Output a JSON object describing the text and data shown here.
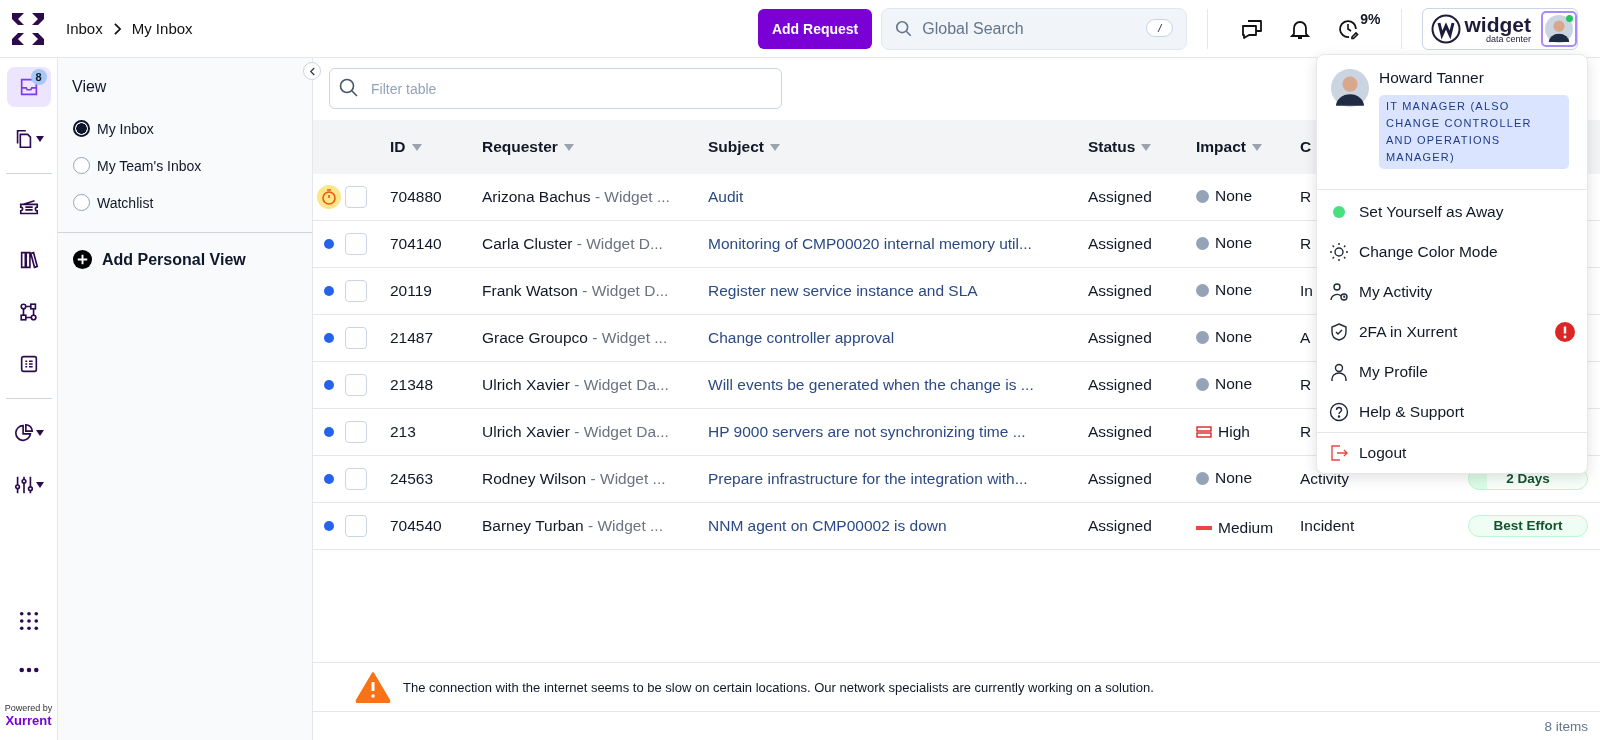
{
  "breadcrumb": [
    {
      "label": "Inbox"
    },
    {
      "label": "My Inbox"
    }
  ],
  "add_request": "Add Request",
  "search": {
    "placeholder": "Global Search",
    "shortcut": "/"
  },
  "usage": "9%",
  "account": {
    "name": "widget",
    "tagline": "data center",
    "online": true
  },
  "rail": {
    "items": [
      {
        "kind": "inbox",
        "selected": true,
        "badge": "8"
      },
      {
        "kind": "documents",
        "selected": false,
        "menu": true
      },
      {
        "kind": "divider"
      },
      {
        "kind": "ticket",
        "selected": false
      },
      {
        "kind": "books",
        "selected": false
      },
      {
        "kind": "workflow",
        "selected": false
      },
      {
        "kind": "list",
        "selected": false
      },
      {
        "kind": "divider"
      },
      {
        "kind": "chart",
        "selected": false,
        "menu": true
      },
      {
        "kind": "sliders",
        "selected": false,
        "menu": true
      }
    ],
    "powered_by": "Powered by",
    "brand": "Xurrent"
  },
  "view_panel": {
    "title": "View",
    "views": [
      {
        "label": "My Inbox",
        "selected": true
      },
      {
        "label": "My Team's Inbox",
        "selected": false
      },
      {
        "label": "Watchlist",
        "selected": false
      }
    ],
    "add": "Add Personal View"
  },
  "filter": {
    "placeholder": "Filter table"
  },
  "table": {
    "columns": [
      {
        "label": "ID",
        "sortable": true
      },
      {
        "label": "Requester",
        "sortable": true
      },
      {
        "label": "Subject",
        "sortable": true
      },
      {
        "label": "Status",
        "sortable": true
      },
      {
        "label": "Impact",
        "sortable": true
      },
      {
        "label": "C",
        "sortable": false
      }
    ],
    "rows": [
      {
        "kind": "timer",
        "checked": false,
        "id": "704880",
        "requester": "Arizona Bachus",
        "organization": "- Widget ...",
        "subject": "Audit",
        "status": "Assigned",
        "impact": {
          "kind": "none",
          "label": "None"
        },
        "category": "R"
      },
      {
        "kind": "unread",
        "checked": false,
        "id": "704140",
        "requester": "Carla Cluster",
        "organization": "- Widget D...",
        "subject": "Monitoring of CMP00020 internal memory util...",
        "status": "Assigned",
        "impact": {
          "kind": "none",
          "label": "None"
        },
        "category": "R"
      },
      {
        "kind": "unread",
        "checked": false,
        "id": "20119",
        "requester": "Frank Watson",
        "organization": "- Widget D...",
        "subject": "Register new service instance and SLA",
        "status": "Assigned",
        "impact": {
          "kind": "none",
          "label": "None"
        },
        "category": "In"
      },
      {
        "kind": "unread",
        "checked": false,
        "id": "21487",
        "requester": "Grace Groupco",
        "organization": "- Widget ...",
        "subject": "Change controller approval",
        "status": "Assigned",
        "impact": {
          "kind": "none",
          "label": "None"
        },
        "category": "A"
      },
      {
        "kind": "unread",
        "checked": false,
        "id": "21348",
        "requester": "Ulrich Xavier",
        "organization": "- Widget Da...",
        "subject": "Will events be generated when the change is ...",
        "status": "Assigned",
        "impact": {
          "kind": "none",
          "label": "None"
        },
        "category": "R"
      },
      {
        "kind": "unread",
        "checked": false,
        "id": "213",
        "requester": "Ulrich Xavier",
        "organization": "- Widget Da...",
        "subject": "HP 9000 servers are not synchronizing time ...",
        "status": "Assigned",
        "impact": {
          "kind": "high",
          "label": "High"
        },
        "category": "R"
      },
      {
        "kind": "unread",
        "checked": false,
        "id": "24563",
        "requester": "Rodney Wilson",
        "organization": "- Widget ...",
        "subject": "Prepare infrastructure for the integration with...",
        "status": "Assigned",
        "impact": {
          "kind": "none",
          "label": "None"
        },
        "category": "Activity",
        "sla": {
          "label": "2 Days"
        }
      },
      {
        "kind": "unread",
        "checked": false,
        "id": "704540",
        "requester": "Barney Turban",
        "organization": "- Widget ...",
        "subject": "NNM agent on CMP00002 is down",
        "status": "Assigned",
        "impact": {
          "kind": "medium",
          "label": "Medium"
        },
        "category": "Incident",
        "sla": {
          "label": "Best Effort"
        }
      }
    ]
  },
  "alert": "The connection with the internet seems to be slow on certain locations. Our network specialists are currently working on a solution.",
  "item_count": "8 items",
  "user_menu": {
    "name": "Howard Tanner",
    "role": "IT MANAGER (ALSO CHANGE CONTROLLER AND OPERATIONS MANAGER)",
    "items": [
      {
        "kind": "away",
        "label": "Set Yourself as Away"
      },
      {
        "kind": "theme",
        "label": "Change Color Mode"
      },
      {
        "kind": "activity",
        "label": "My Activity"
      },
      {
        "kind": "security",
        "label": "2FA in Xurrent",
        "alert": true
      },
      {
        "kind": "profile",
        "label": "My Profile"
      },
      {
        "kind": "help",
        "label": "Help & Support"
      },
      {
        "kind": "logout",
        "label": "Logout"
      }
    ]
  }
}
